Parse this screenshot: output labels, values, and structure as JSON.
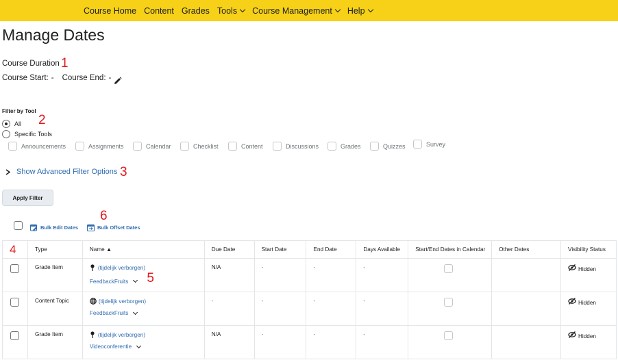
{
  "nav": [
    "Course Home",
    "Content",
    "Grades",
    "Tools",
    "Course Management",
    "Help"
  ],
  "nav_dropdowns": [
    false,
    false,
    false,
    true,
    true,
    true
  ],
  "page_title": "Manage Dates",
  "duration": {
    "heading": "Course Duration",
    "start_label": "Course Start:",
    "start_value": "-",
    "end_label": "Course End:",
    "end_value": "-"
  },
  "filter": {
    "heading": "Filter by Tool",
    "option_all": "All",
    "option_specific": "Specific Tools",
    "tools": [
      "Announcements",
      "Assignments",
      "Calendar",
      "Checklist",
      "Content",
      "Discussions",
      "Grades",
      "Quizzes",
      "Survey"
    ],
    "advanced": "Show Advanced Filter Options",
    "apply": "Apply Filter"
  },
  "bulk": {
    "edit": "Bulk Edit Dates",
    "offset": "Bulk Offset Dates"
  },
  "table": {
    "headers": [
      "Type",
      "Name ▲",
      "Due Date",
      "Start Date",
      "End Date",
      "Days Available",
      "Start/End Dates in Calendar",
      "Other Dates",
      "Visibility Status"
    ],
    "rows": [
      {
        "type": "Grade Item",
        "name": "(tijdelijk verborgen)",
        "tool": "FeedbackFruits",
        "due": "N/A",
        "start": "-",
        "end": "-",
        "days": "-",
        "visibility": "Hidden"
      },
      {
        "type": "Content Topic",
        "name": "(tijdelijk verborgen)",
        "tool": "FeedbackFruits",
        "due": "-",
        "start": "-",
        "end": "-",
        "days": "-",
        "visibility": "Hidden"
      },
      {
        "type": "Grade Item",
        "name": "(tijdelijk verborgen)",
        "tool": "Videoconferentie",
        "due": "N/A",
        "start": "-",
        "end": "-",
        "days": "-",
        "visibility": "Hidden"
      }
    ]
  },
  "annotations": [
    "1",
    "2",
    "3",
    "4",
    "5",
    "6"
  ]
}
